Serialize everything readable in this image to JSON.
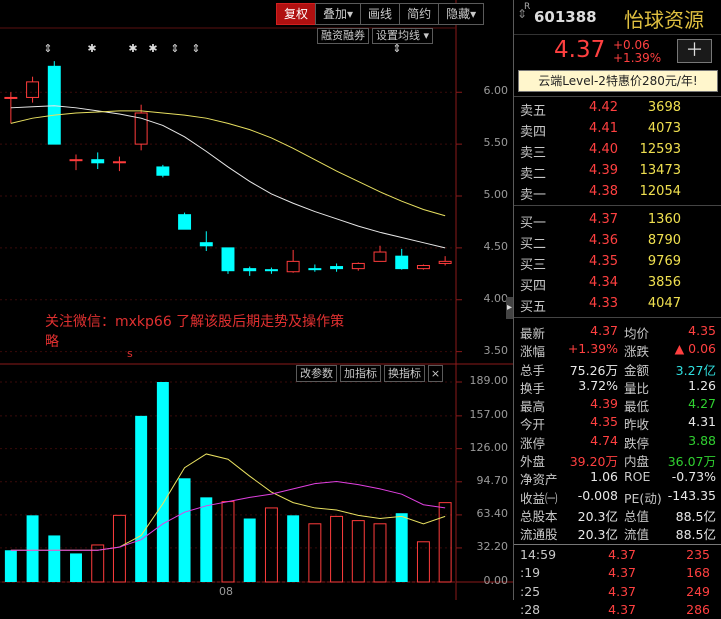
{
  "toolbar": [
    "复权",
    "叠加▾",
    "画线",
    "简约",
    "隐藏▾"
  ],
  "sub_toolbar": [
    "融资融券",
    "设置均线 ▾"
  ],
  "volume_toolbar": [
    "改参数",
    "加指标",
    "换指标"
  ],
  "volume_close": "×",
  "markers": [
    "⇕",
    "✱",
    "✱",
    "✱",
    "⇕",
    "⇕",
    "⇕"
  ],
  "wechat_note": "关注微信：mxkp66 了解该股后期走势及操作策略",
  "small_mark": "s",
  "date_tick": "08",
  "side_handle": "▸",
  "chart_data": [
    {
      "type": "candlestick",
      "title": "",
      "y_ticks": [
        "6.00",
        "5.50",
        "5.00",
        "4.50",
        "4.00",
        "3.50"
      ],
      "ylim": [
        3.4,
        6.6
      ],
      "candles": [
        {
          "o": 5.95,
          "c": 5.95,
          "h": 6.0,
          "l": 5.7
        },
        {
          "o": 5.95,
          "c": 6.1,
          "h": 6.15,
          "l": 5.9
        },
        {
          "o": 6.25,
          "c": 5.5,
          "h": 6.3,
          "l": 5.5
        },
        {
          "o": 5.35,
          "c": 5.35,
          "h": 5.4,
          "l": 5.25
        },
        {
          "o": 5.35,
          "c": 5.32,
          "h": 5.42,
          "l": 5.26
        },
        {
          "o": 5.33,
          "c": 5.33,
          "h": 5.38,
          "l": 5.24
        },
        {
          "o": 5.5,
          "c": 5.8,
          "h": 5.88,
          "l": 5.44
        },
        {
          "o": 5.28,
          "c": 5.2,
          "h": 5.3,
          "l": 5.18
        },
        {
          "o": 4.82,
          "c": 4.68,
          "h": 4.84,
          "l": 4.68
        },
        {
          "o": 4.55,
          "c": 4.52,
          "h": 4.66,
          "l": 4.47
        },
        {
          "o": 4.5,
          "c": 4.28,
          "h": 4.5,
          "l": 4.25
        },
        {
          "o": 4.3,
          "c": 4.28,
          "h": 4.32,
          "l": 4.23
        },
        {
          "o": 4.29,
          "c": 4.28,
          "h": 4.31,
          "l": 4.25
        },
        {
          "o": 4.27,
          "c": 4.37,
          "h": 4.48,
          "l": 4.26
        },
        {
          "o": 4.3,
          "c": 4.29,
          "h": 4.34,
          "l": 4.27
        },
        {
          "o": 4.32,
          "c": 4.3,
          "h": 4.35,
          "l": 4.27
        },
        {
          "o": 4.3,
          "c": 4.35,
          "h": 4.36,
          "l": 4.28
        },
        {
          "o": 4.37,
          "c": 4.46,
          "h": 4.52,
          "l": 4.37
        },
        {
          "o": 4.42,
          "c": 4.3,
          "h": 4.49,
          "l": 4.29
        },
        {
          "o": 4.3,
          "c": 4.33,
          "h": 4.34,
          "l": 4.29
        },
        {
          "o": 4.35,
          "c": 4.37,
          "h": 4.42,
          "l": 4.33
        }
      ],
      "ma_white": [
        5.85,
        5.86,
        5.87,
        5.85,
        5.82,
        5.79,
        5.75,
        5.68,
        5.57,
        5.43,
        5.28,
        5.14,
        5.02,
        4.93,
        4.85,
        4.78,
        4.71,
        4.65,
        4.6,
        4.55,
        4.5
      ],
      "ma_yellow": [
        5.7,
        5.75,
        5.78,
        5.8,
        5.81,
        5.82,
        5.82,
        5.8,
        5.78,
        5.75,
        5.7,
        5.64,
        5.56,
        5.46,
        5.35,
        5.24,
        5.14,
        5.04,
        4.95,
        4.87,
        4.81
      ],
      "colors": {
        "up": "#ff3c3c",
        "down": "#00ffff",
        "ma_white": "#e8e8e8",
        "ma_yellow": "#e8e060"
      }
    },
    {
      "type": "bar",
      "title": "",
      "y_ticks": [
        "189.00",
        "157.00",
        "126.00",
        "94.70",
        "63.40",
        "32.20",
        "0.00"
      ],
      "ylim": [
        0,
        189
      ],
      "values": [
        30,
        63,
        44,
        27,
        35,
        63,
        157,
        189,
        98,
        80,
        76,
        60,
        70,
        63,
        55,
        62,
        58,
        55,
        65,
        38,
        75
      ],
      "directions": [
        "down",
        "down",
        "down",
        "down",
        "up",
        "up",
        "down",
        "down",
        "down",
        "down",
        "up",
        "down",
        "up",
        "down",
        "up",
        "up",
        "up",
        "up",
        "down",
        "up",
        "up"
      ],
      "ma_yellow": [
        30,
        30,
        30,
        30,
        30,
        33,
        44,
        74,
        108,
        121,
        116,
        100,
        85,
        75,
        70,
        68,
        63,
        60,
        62,
        55,
        62
      ],
      "ma_magenta": [
        30,
        30,
        30,
        30,
        30,
        33,
        40,
        55,
        66,
        72,
        76,
        80,
        83,
        88,
        93,
        95,
        92,
        88,
        83,
        73,
        70
      ]
    }
  ],
  "quote": {
    "code_nav": "⇕",
    "code_sup": "R",
    "code": "601388",
    "name": "怡球资源",
    "last": "4.37",
    "change": "+0.06",
    "change_pct": "+1.39%",
    "plus": "＋",
    "promo": "云端Level-2特惠价280元/年!",
    "sell": [
      {
        "label": "卖五",
        "price": "4.42",
        "vol": "3698"
      },
      {
        "label": "卖四",
        "price": "4.41",
        "vol": "4073"
      },
      {
        "label": "卖三",
        "price": "4.40",
        "vol": "12593"
      },
      {
        "label": "卖二",
        "price": "4.39",
        "vol": "13473"
      },
      {
        "label": "卖一",
        "price": "4.38",
        "vol": "12054"
      }
    ],
    "buy": [
      {
        "label": "买一",
        "price": "4.37",
        "vol": "1360"
      },
      {
        "label": "买二",
        "price": "4.36",
        "vol": "8790"
      },
      {
        "label": "买三",
        "price": "4.35",
        "vol": "9769"
      },
      {
        "label": "买四",
        "price": "4.34",
        "vol": "3856"
      },
      {
        "label": "买五",
        "price": "4.33",
        "vol": "4047"
      }
    ],
    "stats": [
      {
        "k1": "最新",
        "v1": "4.37",
        "c1": "red",
        "k2": "均价",
        "v2": "4.35",
        "c2": "red"
      },
      {
        "k1": "涨幅",
        "v1": "+1.39%",
        "c1": "red",
        "k2": "涨跌",
        "v2": "▲ 0.06",
        "c2": "red"
      },
      {
        "k1": "总手",
        "v1": "75.26万",
        "c1": "white",
        "k2": "金额",
        "v2": "3.27亿",
        "c2": "cyan"
      },
      {
        "k1": "换手",
        "v1": "3.72%",
        "c1": "white",
        "k2": "量比",
        "v2": "1.26",
        "c2": "white"
      },
      {
        "k1": "最高",
        "v1": "4.39",
        "c1": "red",
        "k2": "最低",
        "v2": "4.27",
        "c2": "grn"
      },
      {
        "k1": "今开",
        "v1": "4.35",
        "c1": "red",
        "k2": "昨收",
        "v2": "4.31",
        "c2": "white"
      },
      {
        "k1": "涨停",
        "v1": "4.74",
        "c1": "red",
        "k2": "跌停",
        "v2": "3.88",
        "c2": "grn"
      },
      {
        "k1": "外盘",
        "v1": "39.20万",
        "c1": "red",
        "k2": "内盘",
        "v2": "36.07万",
        "c2": "grn"
      },
      {
        "k1": "净资产",
        "v1": "1.06",
        "c1": "white",
        "k2": "ROE",
        "v2": "-0.73%",
        "c2": "white"
      },
      {
        "k1": "收益㈠",
        "v1": "-0.008",
        "c1": "white",
        "k2": "PE(动)",
        "v2": "-143.35",
        "c2": "white"
      },
      {
        "k1": "总股本",
        "v1": "20.3亿",
        "c1": "white",
        "k2": "总值",
        "v2": "88.5亿",
        "c2": "white"
      },
      {
        "k1": "流通股",
        "v1": "20.3亿",
        "c1": "white",
        "k2": "流值",
        "v2": "88.5亿",
        "c2": "white"
      }
    ],
    "ticks": [
      {
        "time": "14:59",
        "price": "4.37",
        "vol": "235"
      },
      {
        "time": ":19",
        "price": "4.37",
        "vol": "168"
      },
      {
        "time": ":25",
        "price": "4.37",
        "vol": "249"
      },
      {
        "time": ":28",
        "price": "4.37",
        "vol": "286"
      }
    ]
  }
}
